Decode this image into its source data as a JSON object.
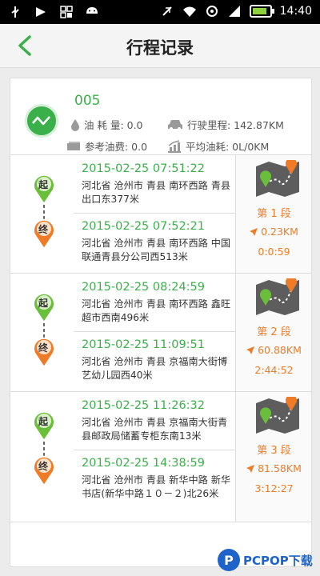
{
  "status_bar": {
    "time": "14:40",
    "battery_level_pct": 85,
    "icons": [
      "usb-icon",
      "notification-icon",
      "grid-icon",
      "android-icon",
      "mute-icon",
      "wifi-icon",
      "data-sync-icon",
      "signal-icon",
      "battery-icon"
    ]
  },
  "header": {
    "title": "行程记录",
    "back_icon": "chevron-left-icon"
  },
  "vehicle": {
    "id": "005",
    "fuel_used": "油 耗 量: 0.0",
    "mileage": "行驶里程: 142.87KM",
    "fuel_cost": "参考油费: 0.0",
    "avg_fuel": "平均油耗: 0L/0KM"
  },
  "trips": [
    {
      "start_time": "2015-02-25 07:51:22",
      "start_addr": "河北省 沧州市 青县 南环西路 青县出口东377米",
      "end_time": "2015-02-25 07:52:21",
      "end_addr": "河北省 沧州市 青县 南环西路 中国联通青县分公司西513米",
      "segment": "第 1 段",
      "distance": "0.23KM",
      "duration": "0:0:59"
    },
    {
      "start_time": "2015-02-25 08:24:59",
      "start_addr": "河北省 沧州市 青县 南环西路 鑫旺超市西南496米",
      "end_time": "2015-02-25 11:09:51",
      "end_addr": "河北省 沧州市 青县 京福南大街博艺幼儿园西40米",
      "segment": "第 2 段",
      "distance": "60.88KM",
      "duration": "2:44:52"
    },
    {
      "start_time": "2015-02-25 11:26:32",
      "start_addr": "河北省 沧州市 青县 京福南大街青县邮政局储蓄专柜东南13米",
      "end_time": "2015-02-25 14:38:59",
      "end_addr": "河北省 沧州市 青县 新华中路 新华书店(新华中路１０－２)北26米",
      "segment": "第 3 段",
      "distance": "81.58KM",
      "duration": "3:12:27"
    }
  ],
  "markers": {
    "start": "起",
    "end": "终"
  },
  "watermark": {
    "text": "PCPOP下载",
    "logo_letter": "P"
  },
  "colors": {
    "accent_green": "#3bb04a",
    "accent_orange": "#f07b26"
  }
}
